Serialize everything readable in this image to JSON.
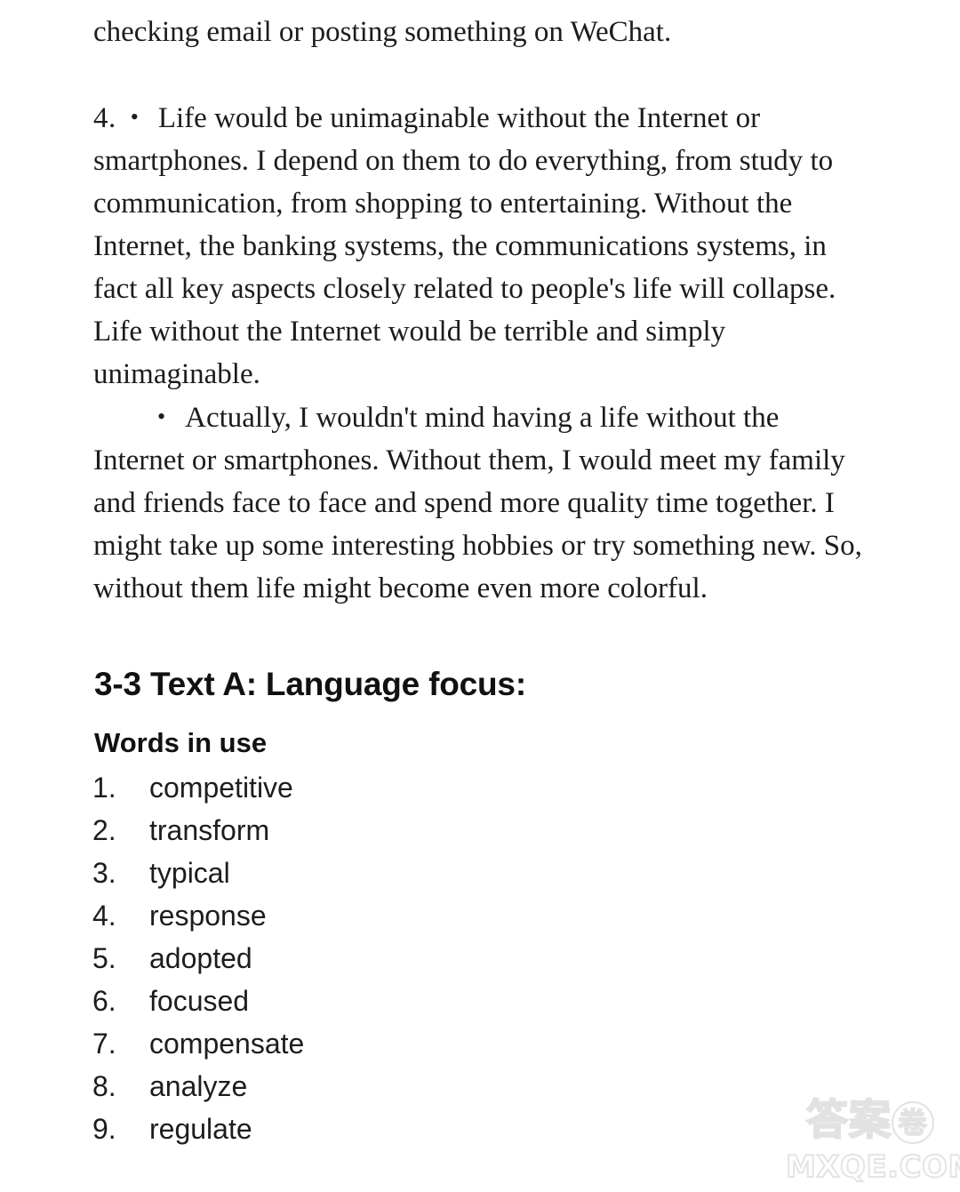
{
  "document": {
    "background_color": "#ffffff",
    "body_text_color": "#1c1c1c"
  },
  "answer_body": {
    "continuation_line": "checking email or posting something on WeChat.",
    "question_number": "4.",
    "bullet_glyph": "•",
    "bullets": [
      {
        "text": "Life would be unimaginable without the Internet or smartphones. I depend on them to do everything, from study to communication, from shopping to entertaining. Without the Internet, the banking systems, the communications systems, in fact all key aspects closely related to people's life will collapse. Life without the Internet would be terrible and simply unimaginable."
      },
      {
        "text": "Actually, I wouldn't mind having a life without the Internet or smartphones. Without them, I would meet my family and friends face to face and spend more quality time together. I might take up some interesting hobbies or try something new. So, without them life might become even more colorful."
      }
    ]
  },
  "language_focus": {
    "heading": "3-3 Text A: Language focus:",
    "subheading": "Words in use",
    "items": [
      {
        "number": "1.",
        "word": "competitive"
      },
      {
        "number": "2.",
        "word": "transform"
      },
      {
        "number": "3.",
        "word": "typical"
      },
      {
        "number": "4.",
        "word": "response"
      },
      {
        "number": "5.",
        "word": "adopted"
      },
      {
        "number": "6.",
        "word": "focused"
      },
      {
        "number": "7.",
        "word": "compensate"
      },
      {
        "number": "8.",
        "word": "analyze"
      },
      {
        "number": "9.",
        "word": "regulate"
      }
    ]
  },
  "watermark": {
    "chinese_prefix": "答案",
    "chinese_circled": "卷",
    "domain": "MXQE.COM",
    "color": "#e3e3e3"
  }
}
